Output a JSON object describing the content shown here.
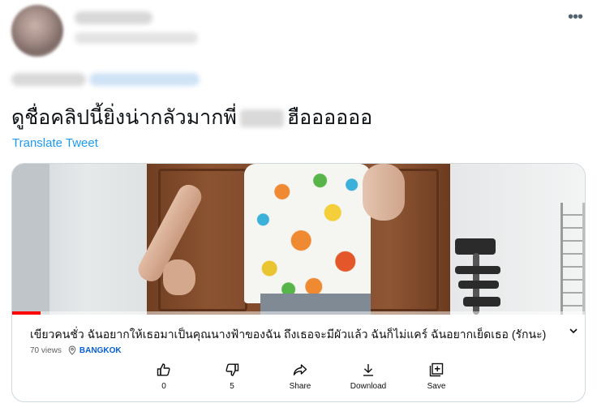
{
  "tweet": {
    "more_icon": "more-horizontal-icon",
    "text_before": "ดูชื่อคลิปนี้ยิ่งน่ากลัวมากพี่",
    "text_after": "ฮืออออออ",
    "translate_label": "Translate Tweet"
  },
  "video": {
    "title": "เขียวคนชั่ว ฉันอยากให้เธอมาเป็นคุณนางฟ้าของฉัน ถึงเธอจะมีผัวแล้ว ฉันก็ไม่แคร์ ฉันอยากเย็ดเธอ (รักนะ)",
    "views": "70 views",
    "location": "BANGKOK",
    "progress_fraction": 0.05,
    "progress_color": "#ff0000",
    "actions": [
      {
        "label": "0",
        "icon": "thumbs-up-icon"
      },
      {
        "label": "5",
        "icon": "thumbs-down-icon"
      },
      {
        "label": "Share",
        "icon": "share-icon"
      },
      {
        "label": "Download",
        "icon": "download-icon"
      },
      {
        "label": "Save",
        "icon": "save-icon"
      }
    ]
  },
  "colors": {
    "link": "#1d9bf0",
    "location": "#065fd4",
    "text": "#0f1419"
  }
}
